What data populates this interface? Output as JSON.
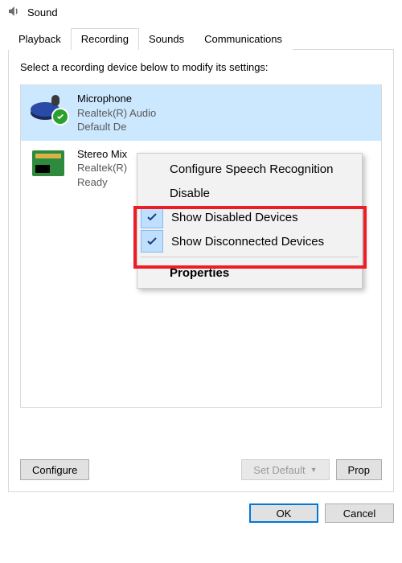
{
  "window": {
    "title": "Sound"
  },
  "tabs": {
    "playback": "Playback",
    "recording": "Recording",
    "sounds": "Sounds",
    "communications": "Communications",
    "active": "recording"
  },
  "instruction": "Select a recording device below to modify its settings:",
  "devices": [
    {
      "name": "Microphone",
      "sub": "Realtek(R) Audio",
      "status": "Default De",
      "selected": true
    },
    {
      "name": "Stereo Mix",
      "sub": "Realtek(R)",
      "status": "Ready",
      "selected": false
    }
  ],
  "context_menu": {
    "configure_speech": "Configure Speech Recognition",
    "disable": "Disable",
    "show_disabled": "Show Disabled Devices",
    "show_disconnected": "Show Disconnected Devices",
    "properties": "Properties"
  },
  "panel_buttons": {
    "configure": "Configure",
    "set_default": "Set Default",
    "properties": "Prop"
  },
  "bottom_buttons": {
    "ok": "OK",
    "cancel": "Cancel"
  }
}
